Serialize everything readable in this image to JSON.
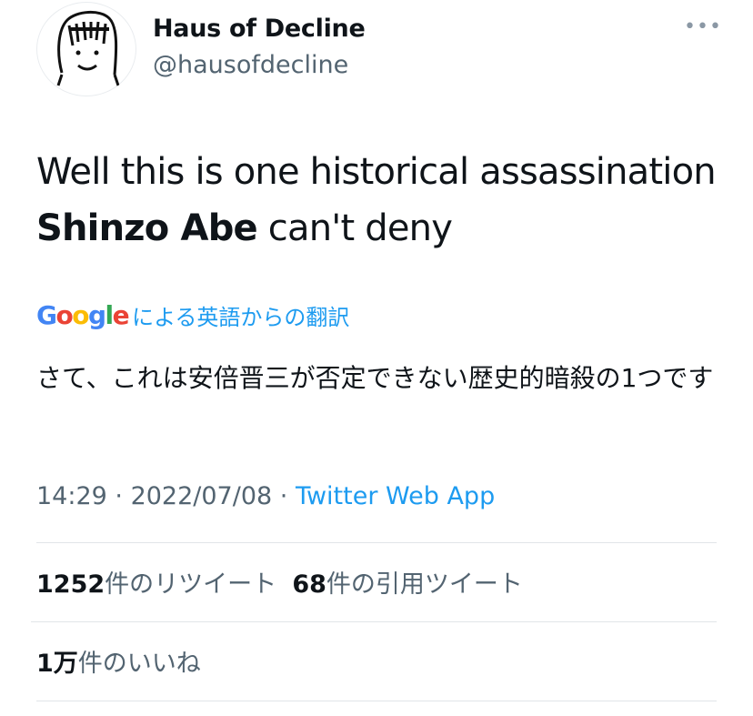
{
  "author": {
    "name": "Haus of Decline",
    "handle": "@hausofdecline"
  },
  "tweet": {
    "text_before": "Well this is one historical assassination ",
    "text_bold": "Shinzo Abe",
    "text_after": " can't deny"
  },
  "translation": {
    "logo_letters": [
      "G",
      "o",
      "o",
      "g",
      "l",
      "e"
    ],
    "logo_colors": [
      "#4285F4",
      "#EA4335",
      "#FBBC05",
      "#4285F4",
      "#34A853",
      "#EA4335"
    ],
    "label": "による英語からの翻訳",
    "text": "さて、これは安倍晋三が否定できない歴史的暗殺の1つです"
  },
  "meta": {
    "time": "14:29",
    "sep1": " · ",
    "date": "2022/07/08",
    "sep2": " · ",
    "app": "Twitter Web App"
  },
  "stats": {
    "retweets_count": "1252",
    "retweets_label": "件のリツイート",
    "quotes_count": "68",
    "quotes_label": "件の引用ツイート",
    "likes_count": "1万",
    "likes_label": "件のいいね"
  },
  "icons": {
    "more": "more-horizontal-icon"
  },
  "colors": {
    "link": "#1d9bf0",
    "secondary": "#536471",
    "text": "#0f1419"
  }
}
